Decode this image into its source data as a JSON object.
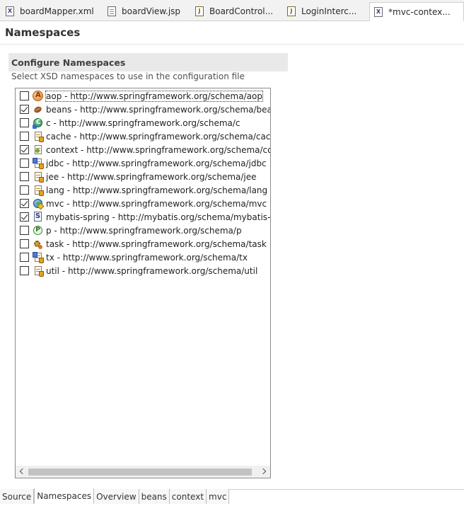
{
  "editor_tabs": [
    {
      "label": "boardMapper.xml",
      "icon": "xml-file-icon",
      "active": false
    },
    {
      "label": "boardView.jsp",
      "icon": "jsp-file-icon",
      "active": false
    },
    {
      "label": "BoardControl...",
      "icon": "java-file-icon",
      "active": false
    },
    {
      "label": "LoginInterc...",
      "icon": "java-file-icon",
      "active": false
    },
    {
      "label": "*mvc-contex...",
      "icon": "xml-file-icon",
      "active": true
    }
  ],
  "page": {
    "title": "Namespaces"
  },
  "section": {
    "title": "Configure Namespaces",
    "description": "Select XSD namespaces to use in the configuration file"
  },
  "namespaces": [
    {
      "label": "aop - http://www.springframework.org/schema/aop",
      "checked": false,
      "icon": "aop-icon"
    },
    {
      "label": "beans - http://www.springframework.org/schema/beans",
      "checked": true,
      "icon": "bean-icon"
    },
    {
      "label": "c - http://www.springframework.org/schema/c",
      "checked": false,
      "icon": "c-namespace-icon"
    },
    {
      "label": "cache - http://www.springframework.org/schema/cache",
      "checked": false,
      "icon": "cache-icon"
    },
    {
      "label": "context - http://www.springframework.org/schema/context",
      "checked": true,
      "icon": "context-icon"
    },
    {
      "label": "jdbc - http://www.springframework.org/schema/jdbc",
      "checked": false,
      "icon": "jdbc-icon"
    },
    {
      "label": "jee - http://www.springframework.org/schema/jee",
      "checked": false,
      "icon": "jee-icon"
    },
    {
      "label": "lang - http://www.springframework.org/schema/lang",
      "checked": false,
      "icon": "lang-icon"
    },
    {
      "label": "mvc - http://www.springframework.org/schema/mvc",
      "checked": true,
      "icon": "mvc-icon"
    },
    {
      "label": "mybatis-spring - http://mybatis.org/schema/mybatis-spring",
      "checked": true,
      "icon": "mybatis-icon"
    },
    {
      "label": "p - http://www.springframework.org/schema/p",
      "checked": false,
      "icon": "p-namespace-icon"
    },
    {
      "label": "task - http://www.springframework.org/schema/task",
      "checked": false,
      "icon": "task-icon"
    },
    {
      "label": "tx - http://www.springframework.org/schema/tx",
      "checked": false,
      "icon": "tx-icon"
    },
    {
      "label": "util - http://www.springframework.org/schema/util",
      "checked": false,
      "icon": "util-icon"
    }
  ],
  "page_tabs": [
    {
      "label": "Source",
      "active": false
    },
    {
      "label": "Namespaces",
      "active": true
    },
    {
      "label": "Overview",
      "active": false
    },
    {
      "label": "beans",
      "active": false
    },
    {
      "label": "context",
      "active": false
    },
    {
      "label": "mvc",
      "active": false
    }
  ]
}
